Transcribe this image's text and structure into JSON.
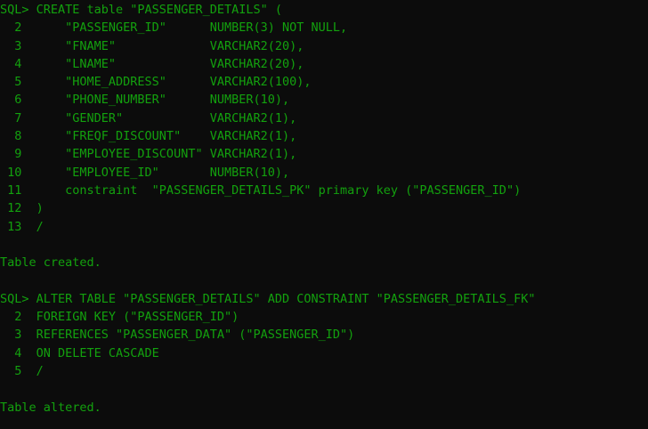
{
  "terminal": {
    "lines": [
      "SQL> CREATE table \"PASSENGER_DETAILS\" (",
      "  2      \"PASSENGER_ID\"      NUMBER(3) NOT NULL,",
      "  3      \"FNAME\"             VARCHAR2(20),",
      "  4      \"LNAME\"             VARCHAR2(20),",
      "  5      \"HOME_ADDRESS\"      VARCHAR2(100),",
      "  6      \"PHONE_NUMBER\"      NUMBER(10),",
      "  7      \"GENDER\"            VARCHAR2(1),",
      "  8      \"FREQF_DISCOUNT\"    VARCHAR2(1),",
      "  9      \"EMPLOYEE_DISCOUNT\" VARCHAR2(1),",
      " 10      \"EMPLOYEE_ID\"       NUMBER(10),",
      " 11      constraint  \"PASSENGER_DETAILS_PK\" primary key (\"PASSENGER_ID\")",
      " 12  )",
      " 13  /",
      "",
      "Table created.",
      "",
      "SQL> ALTER TABLE \"PASSENGER_DETAILS\" ADD CONSTRAINT \"PASSENGER_DETAILS_FK\"",
      "  2  FOREIGN KEY (\"PASSENGER_ID\")",
      "  3  REFERENCES \"PASSENGER_DATA\" (\"PASSENGER_ID\")",
      "  4  ON DELETE CASCADE",
      "  5  /",
      "",
      "Table altered."
    ]
  },
  "colors": {
    "background": "#0c0c0c",
    "text": "#13a10e"
  }
}
